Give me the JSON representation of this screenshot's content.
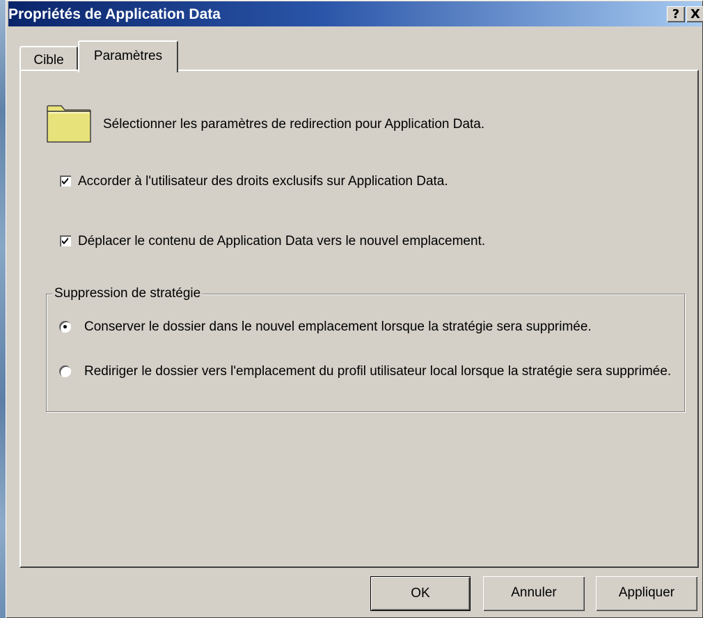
{
  "window": {
    "title": "Propriétés de Application Data",
    "help_glyph": "?",
    "close_glyph": "X"
  },
  "tabs": [
    {
      "label": "Cible",
      "selected": false
    },
    {
      "label": "Paramètres",
      "selected": true
    }
  ],
  "settings": {
    "intro": "Sélectionner les paramètres de redirection pour Application Data.",
    "icon": "folder-icon",
    "checkboxes": [
      {
        "label": "Accorder à l'utilisateur des droits exclusifs sur Application Data.",
        "checked": true
      },
      {
        "label": "Déplacer le contenu de Application Data vers le nouvel emplacement.",
        "checked": true
      }
    ],
    "policy_group": {
      "legend": "Suppression de stratégie",
      "options": [
        {
          "label": "Conserver le dossier dans le nouvel emplacement lorsque la stratégie sera supprimée.",
          "selected": true
        },
        {
          "label": "Rediriger le dossier vers l'emplacement du profil utilisateur local lorsque la stratégie sera supprimée.",
          "selected": false
        }
      ]
    }
  },
  "buttons": {
    "ok": "OK",
    "cancel": "Annuler",
    "apply": "Appliquer"
  },
  "colors": {
    "titlebar_start": "#0a246a",
    "titlebar_end": "#a6caf0",
    "face": "#d4d0c8",
    "folder": "#e8e27a"
  }
}
